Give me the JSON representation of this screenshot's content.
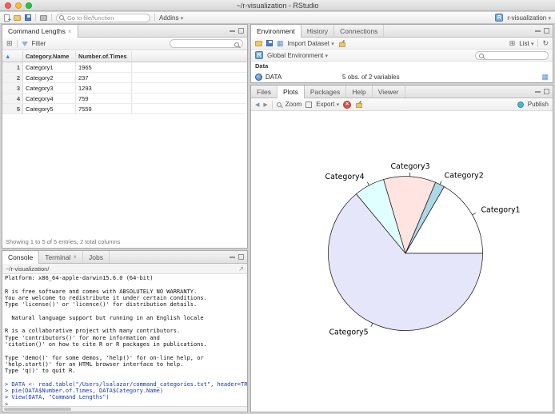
{
  "window": {
    "title": "~/r-visualization - RStudio"
  },
  "toolbar": {
    "goto_placeholder": "Go to file/function",
    "addins_label": "Addins",
    "project_label": "r-visualization"
  },
  "viewer": {
    "tab": "Command Lengths",
    "filter_label": "Filter",
    "table": {
      "headers": [
        "",
        "Category.Name",
        "Number.of.Times"
      ],
      "rows": [
        [
          "1",
          "Category1",
          "1965"
        ],
        [
          "2",
          "Category2",
          "237"
        ],
        [
          "3",
          "Category3",
          "1293"
        ],
        [
          "4",
          "Category4",
          "759"
        ],
        [
          "5",
          "Category5",
          "7559"
        ]
      ]
    },
    "status": "Showing 1 to 5 of 5 entries, 2 total columns"
  },
  "console": {
    "tabs": [
      "Console",
      "Terminal",
      "Jobs"
    ],
    "path": "~/r-visualization/",
    "lines": [
      {
        "t": "Platform: x86_64-apple-darwin15.6.0 (64-bit)",
        "k": "out"
      },
      {
        "t": "",
        "k": "out"
      },
      {
        "t": "R is free software and comes with ABSOLUTELY NO WARRANTY.",
        "k": "out"
      },
      {
        "t": "You are welcome to redistribute it under certain conditions.",
        "k": "out"
      },
      {
        "t": "Type 'license()' or 'licence()' for distribution details.",
        "k": "out"
      },
      {
        "t": "",
        "k": "out"
      },
      {
        "t": "  Natural language support but running in an English locale",
        "k": "out"
      },
      {
        "t": "",
        "k": "out"
      },
      {
        "t": "R is a collaborative project with many contributors.",
        "k": "out"
      },
      {
        "t": "Type 'contributors()' for more information and",
        "k": "out"
      },
      {
        "t": "'citation()' on how to cite R or R packages in publications.",
        "k": "out"
      },
      {
        "t": "",
        "k": "out"
      },
      {
        "t": "Type 'demo()' for some demos, 'help()' for on-line help, or",
        "k": "out"
      },
      {
        "t": "'help.start()' for an HTML browser interface to help.",
        "k": "out"
      },
      {
        "t": "Type 'q()' to quit R.",
        "k": "out"
      },
      {
        "t": "",
        "k": "out"
      },
      {
        "t": "> DATA <- read.table(\"/Users/lsalazar/command_categories.txt\", header=TRUE)",
        "k": "in"
      },
      {
        "t": "> pie(DATA$Number.of.Times, DATA$Category.Name)",
        "k": "in"
      },
      {
        "t": "> View(DATA, \"Command Lengths\")",
        "k": "in"
      },
      {
        "t": "> ",
        "k": "in"
      }
    ]
  },
  "environment": {
    "tabs": [
      "Environment",
      "History",
      "Connections"
    ],
    "import_label": "Import Dataset",
    "list_label": "List",
    "scope_label": "Global Environment",
    "section_label": "Data",
    "entries": [
      {
        "name": "DATA",
        "desc": "5 obs. of 2 variables"
      }
    ]
  },
  "plots": {
    "tabs": [
      "Files",
      "Plots",
      "Packages",
      "Help",
      "Viewer"
    ],
    "zoom_label": "Zoom",
    "export_label": "Export",
    "publish_label": "Publish"
  },
  "chart_data": {
    "type": "pie",
    "categories": [
      "Category1",
      "Category2",
      "Category3",
      "Category4",
      "Category5"
    ],
    "values": [
      1965,
      237,
      1293,
      759,
      7559
    ],
    "colors": [
      "#FFFFFF",
      "#ADD8E6",
      "#FFE4E1",
      "#E0FFFF",
      "#E6E6FA"
    ],
    "start_angle_deg": 0,
    "direction": "counterclockwise",
    "title": "",
    "legend": "labels-around-pie"
  }
}
